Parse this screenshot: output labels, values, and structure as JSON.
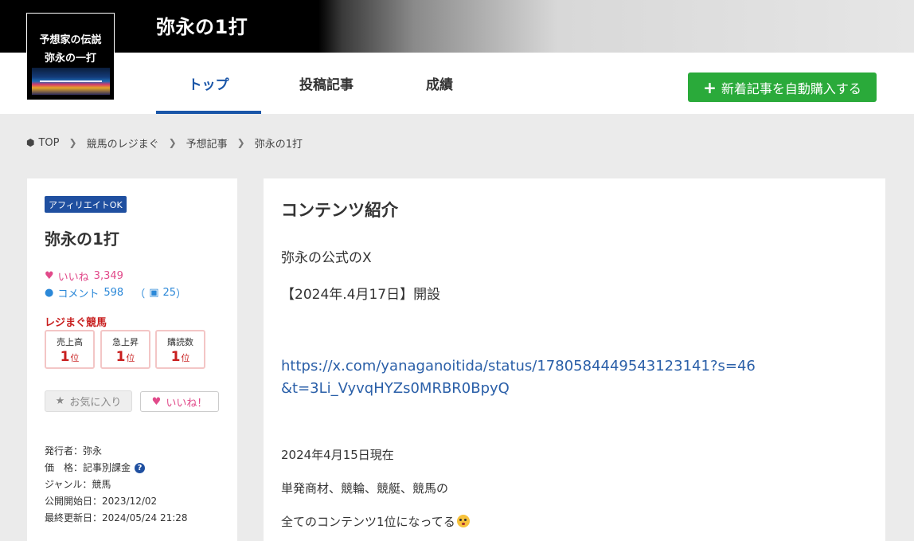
{
  "header": {
    "site_title": "弥永の1打",
    "logo": {
      "line1": "予想家の伝説",
      "line2": "弥永の一打"
    }
  },
  "nav": {
    "tabs": [
      {
        "label": "トップ",
        "active": true
      },
      {
        "label": "投稿記事",
        "active": false
      },
      {
        "label": "成績",
        "active": false
      }
    ],
    "cta_label": "新着記事を自動購入する"
  },
  "breadcrumb": [
    "TOP",
    "競馬のレジまぐ",
    "予想記事",
    "弥永の1打"
  ],
  "sidebar": {
    "badge": "アフィリエイトOK",
    "title": "弥永の1打",
    "likes_label": "いいね",
    "likes_count": "3,349",
    "comments_label": "コメント",
    "comments_count": "598",
    "gift_open": "（",
    "gift_count": "25",
    "gift_close": "）",
    "ranking_title": "レジまぐ競馬",
    "rankings": [
      {
        "label": "売上高",
        "rank": "1",
        "unit": "位"
      },
      {
        "label": "急上昇",
        "rank": "1",
        "unit": "位"
      },
      {
        "label": "購読数",
        "rank": "1",
        "unit": "位"
      }
    ],
    "favorite_label": "お気に入り",
    "like_button_label": "いいね！",
    "meta": {
      "publisher": "発行者：弥永",
      "price": "価　格：記事別課金",
      "genre": "ジャンル：競馬",
      "start": "公開開始日：2023/12/02",
      "updated": "最終更新日：2024/05/24 21:28"
    }
  },
  "content": {
    "section_title": "コンテンツ紹介",
    "line1": "弥永の公式のX",
    "line2": "【2024年.4月17日】開設",
    "url": "https://x.com/yanaganoitida/status/1780584449543123141?s=46&t=3Li_VyvqHYZs0MRBR0BpyQ",
    "line3": "2024年4月15日現在",
    "line4": "単発商材、競輪、競艇、競馬の",
    "line5": "全てのコンテンツ1位になってる"
  },
  "colors": {
    "accent": "#1a56a8",
    "cta": "#2aaa3a",
    "like": "#e14a8a",
    "comment": "#2b88d8",
    "ranking": "#c81e1e"
  }
}
